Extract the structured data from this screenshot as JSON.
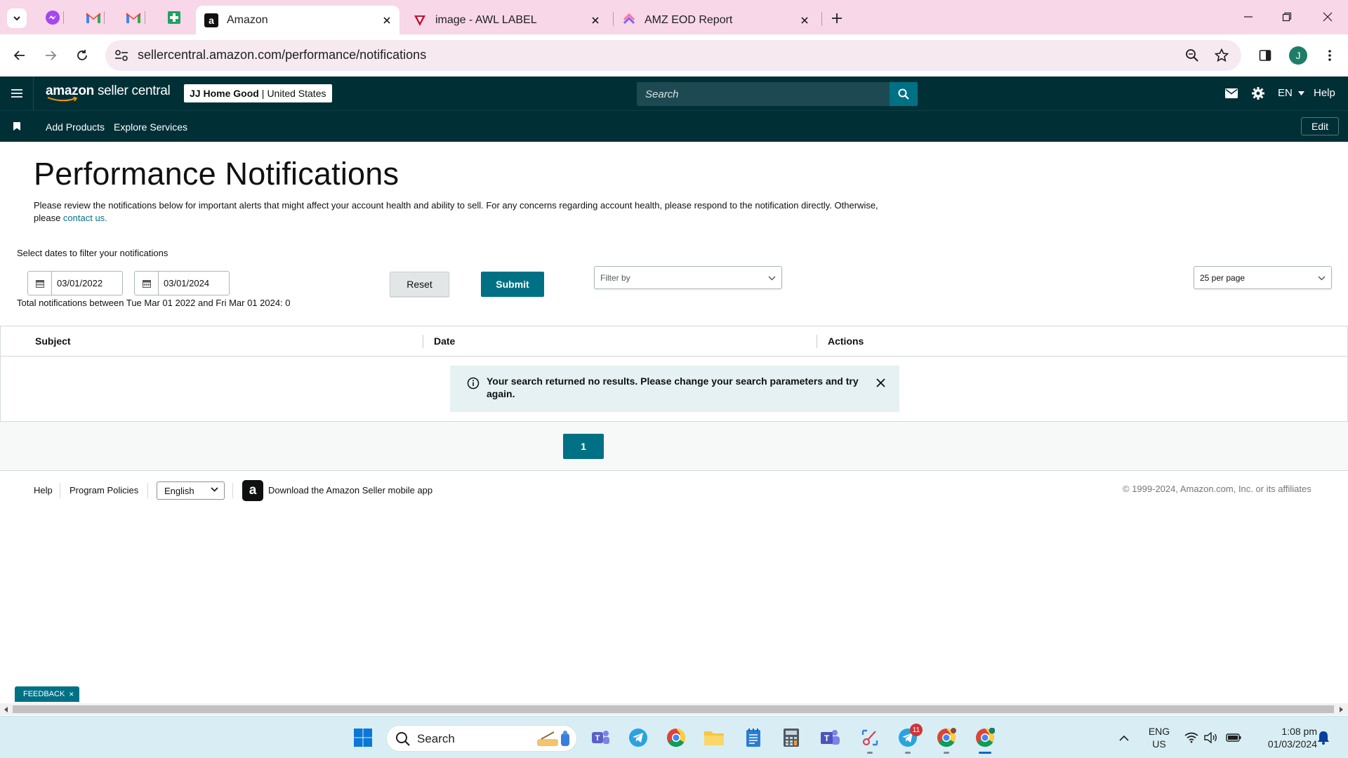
{
  "browser": {
    "tabs": [
      {
        "title": "Amazon",
        "active": true,
        "favicon": "amazon-favicon"
      },
      {
        "title": "image - AWL LABEL",
        "active": false,
        "favicon": "awl-favicon"
      },
      {
        "title": "AMZ EOD Report",
        "active": false,
        "favicon": "clickup-favicon"
      }
    ],
    "pinned_tabs": [
      "messenger-favicon",
      "gmail-favicon",
      "gmail-favicon",
      "google-sheets-favicon"
    ],
    "url": "sellercentral.amazon.com/performance/notifications",
    "profile_initial": "J"
  },
  "header": {
    "logo_word1": "amazon",
    "logo_word2": "seller central",
    "store_name": "JJ Home Good",
    "store_sep": "|",
    "store_region": "United States",
    "search_placeholder": "Search",
    "language": "EN",
    "help": "Help",
    "subnav": {
      "add_products": "Add Products",
      "explore_services": "Explore Services",
      "edit": "Edit"
    }
  },
  "page": {
    "title": "Performance Notifications",
    "desc_text": "Please review the notifications below for important alerts that might affect your account health and ability to sell. For any concerns regarding account health, please respond to the notification directly. Otherwise, please ",
    "desc_link": "contact us.",
    "filter_label": "Select dates to filter your notifications",
    "start_date": "03/01/2022",
    "end_date": "03/01/2024",
    "total_text": "Total notifications between Tue Mar 01 2022 and Fri Mar 01 2024: 0",
    "reset": "Reset",
    "submit": "Submit",
    "filter_placeholder": "Filter by",
    "per_page": "25 per page",
    "columns": [
      "Subject",
      "Date",
      "Actions"
    ],
    "alert": "Your search returned no results. Please change your search parameters and try again.",
    "current_page": "1"
  },
  "footer": {
    "help": "Help",
    "program_policies": "Program Policies",
    "language": "English",
    "app_text": "Download the Amazon Seller mobile app",
    "copyright": "© 1999-2024, Amazon.com, Inc. or its affiliates",
    "feedback": "FEEDBACK",
    "feedback_close": "×"
  },
  "taskbar": {
    "search": "Search",
    "lang_line1": "ENG",
    "lang_line2": "US",
    "time": "1:08 pm",
    "date": "01/03/2024",
    "telegram_badge": "11"
  },
  "colors": {
    "header_bg": "#002f36",
    "teal": "#007185",
    "tabstrip": "#f7d7e8"
  }
}
